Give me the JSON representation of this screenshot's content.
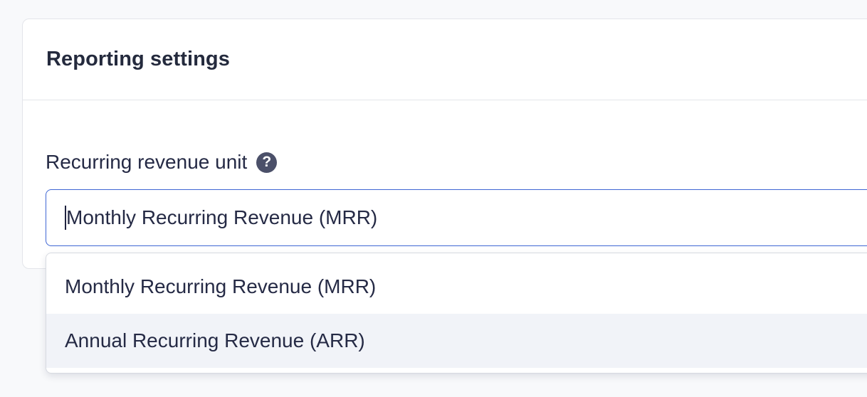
{
  "card": {
    "title": "Reporting settings"
  },
  "field": {
    "label": "Recurring revenue unit",
    "help_glyph": "?",
    "help_icon": "question-circle-icon",
    "selected_value": "Monthly Recurring Revenue (MRR)"
  },
  "dropdown": {
    "options": [
      {
        "label": "Monthly Recurring Revenue (MRR)",
        "highlighted": false
      },
      {
        "label": "Annual Recurring Revenue (ARR)",
        "highlighted": true
      }
    ]
  },
  "colors": {
    "accent_border": "#3f66d4",
    "highlight_bg": "#f1f3f8",
    "text": "#252a45"
  }
}
